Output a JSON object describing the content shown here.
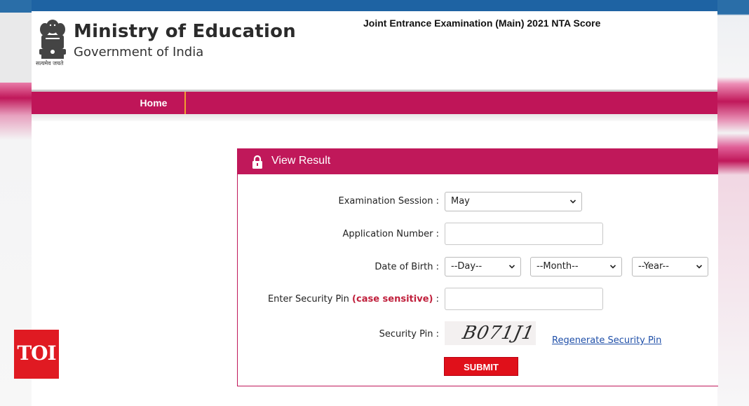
{
  "header": {
    "ministry": "Ministry of Education",
    "government": "Government of India",
    "motto": "सत्यमेव जयते",
    "exam_title": "Joint Entrance Examination (Main) 2021 NTA Score"
  },
  "nav": {
    "home": "Home"
  },
  "panel": {
    "title": "View Result",
    "fields": {
      "session_label": "Examination Session :",
      "session_value": "May",
      "application_label": "Application Number :",
      "application_value": "",
      "dob_label": "Date of Birth :",
      "dob_day": "--Day--",
      "dob_month": "--Month--",
      "dob_year": "--Year--",
      "pin_label_prefix": "Enter Security Pin",
      "pin_label_red": "(case sensitive)",
      "pin_label_suffix": ":",
      "pin_value": "",
      "captcha_label": "Security Pin :",
      "captcha_text": "B071J1",
      "regenerate": "Regenerate Security Pin",
      "submit": "SUBMIT"
    }
  },
  "watermark": {
    "toi": "TOI"
  },
  "colors": {
    "brand": "#c0185a",
    "topbar": "#1e63a3",
    "submit": "#e0101a",
    "link": "#1f4fa8"
  }
}
